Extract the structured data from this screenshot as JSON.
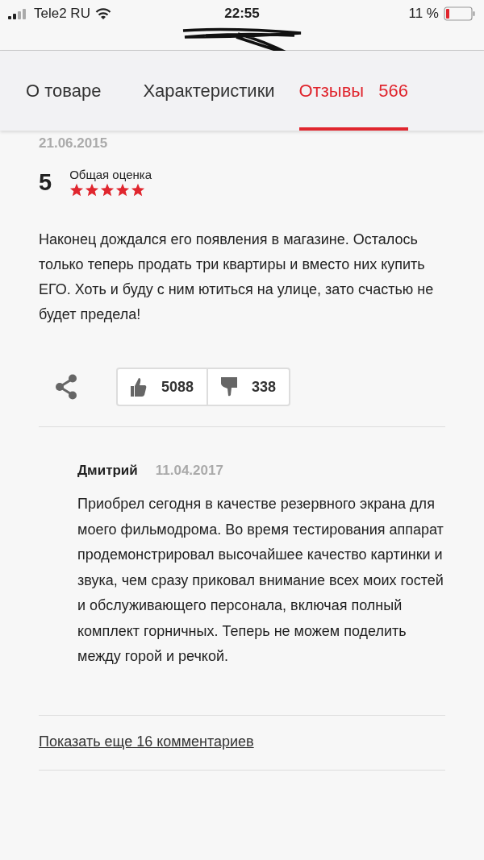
{
  "status_bar": {
    "carrier": "Tele2 RU",
    "time": "22:55",
    "battery": "11 %"
  },
  "tabs": [
    {
      "label": "О товаре",
      "selected": false
    },
    {
      "label": "Характеристики",
      "selected": false
    },
    {
      "label": "Отзывы",
      "count": "566",
      "selected": true
    }
  ],
  "review": {
    "date": "21.06.2015",
    "rating": "5",
    "rating_label": "Общая оценка",
    "stars": 5,
    "text": "Наконец дождался его появления в магазине. Осталось только теперь продать три квартиры и вместо них купить ЕГО. Хоть и буду с ним ютиться на улице, зато счастью не будет предела!",
    "likes": "5088",
    "dislikes": "338"
  },
  "comments": [
    {
      "author": "Дмитрий",
      "date": "11.04.2017",
      "text": "Приобрел сегодня в качестве резервного экрана для моего фильмодрома. Во время тестирования аппарат продемонстрировал высочайшее качество картинки и звука, чем сразу приковал внимание всех моих гостей и обслуживающего персонала, включая полный комплект горничных. Теперь не можем поделить между горой и речкой."
    }
  ],
  "more_link": "Показать еще 16 комментариев"
}
